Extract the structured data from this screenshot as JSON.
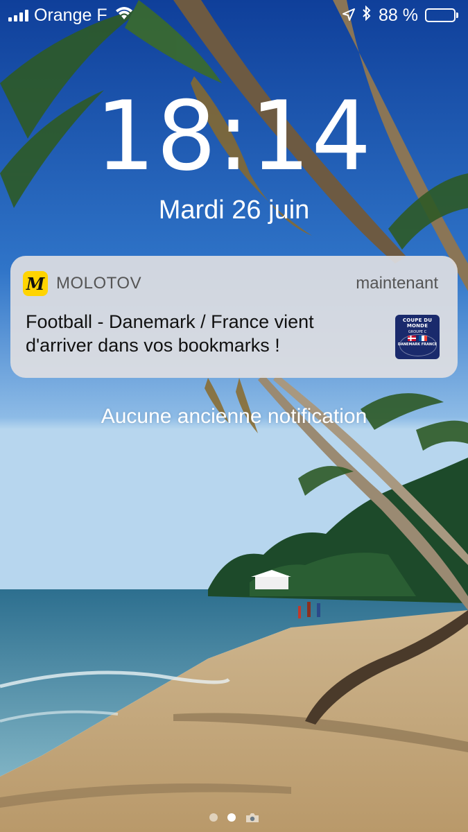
{
  "status_bar": {
    "carrier": "Orange F",
    "signal_bars": 4,
    "battery_text": "88 %",
    "battery_level": 0.88,
    "icons": [
      "signal-icon",
      "wifi-icon",
      "location-arrow-icon",
      "bluetooth-icon",
      "battery-icon"
    ]
  },
  "lock_screen": {
    "time": "18:14",
    "date": "Mardi 26 juin",
    "no_older_notifications": "Aucune ancienne notification"
  },
  "notification": {
    "app_name": "MOLOTOV",
    "app_icon_letter": "M",
    "time": "maintenant",
    "message": "Football - Danemark / France vient d'arriver dans vos bookmarks !",
    "thumbnail": {
      "line1": "COUPE DU MONDE",
      "line2": "GROUPE C",
      "line3": "DANEMARK FRANCE"
    }
  },
  "pager": {
    "pages": 2,
    "active_index": 1,
    "icons": [
      "camera-icon"
    ]
  },
  "colors": {
    "notification_bg": "#dedee2",
    "app_icon_bg": "#ffd400",
    "thumbnail_bg": "#1a2a6c",
    "text_white": "#ffffff"
  }
}
